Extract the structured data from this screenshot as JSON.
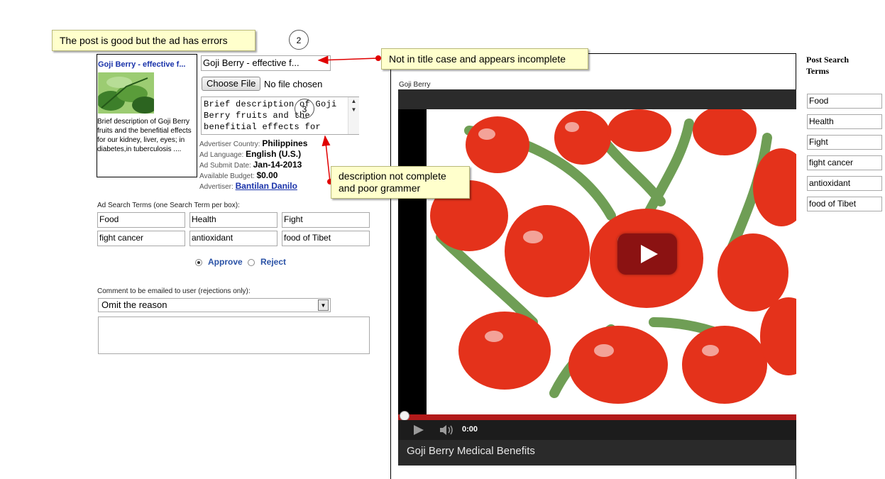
{
  "callouts": {
    "main": "The post is good but the ad has errors",
    "title_note": "Not in title case and appears incomplete",
    "desc_note_line1": "description not complete",
    "desc_note_line2": "and poor grammer",
    "step2": "2",
    "step3": "3"
  },
  "ad": {
    "title": "Goji Berry - effective f...",
    "description": "Brief description of Goji Berry fruits and the benefitial effects for our kidney, liver, eyes; in diabetes,in tuberculosis ....",
    "title_input": "Goji Berry - effective f...",
    "choose_file_label": "Choose File",
    "file_status": "No file chosen",
    "description_input": "Brief description of Goji Berry fruits and the benefitial   effects for"
  },
  "meta": {
    "country_label": "Advertiser Country:",
    "country": "Philippines",
    "language_label": "Ad Language:",
    "language": "English (U.S.)",
    "submit_label": "Ad Submit Date:",
    "submit_date": "Jan-14-2013",
    "budget_label": "Available Budget:",
    "budget": "$0.00",
    "advertiser_label": "Advertiser:",
    "advertiser": "Bantilan Danilo"
  },
  "search_terms": {
    "label": "Ad Search Terms (one Search Term per box):",
    "terms": [
      "Food",
      "Health",
      "Fight",
      "fight cancer",
      "antioxidant",
      "food of Tibet"
    ]
  },
  "decision": {
    "approve": "Approve",
    "reject": "Reject"
  },
  "comment": {
    "label": "Comment to be emailed to user (rejections only):",
    "selected": "Omit the reason"
  },
  "post": {
    "name": "Goji Berry",
    "video_title": "Goji Berry Medical Benefits",
    "time": "0:00"
  },
  "post_search": {
    "heading_line1": "Post Search",
    "heading_line2": "Terms",
    "terms": [
      "Food",
      "Health",
      "Fight",
      "fight cancer",
      "antioxidant",
      "food of Tibet"
    ]
  },
  "colors": {
    "callout_bg": "#ffffcc",
    "arrow": "#e00000",
    "link": "#1a33aa",
    "progress": "#b21a1a"
  }
}
